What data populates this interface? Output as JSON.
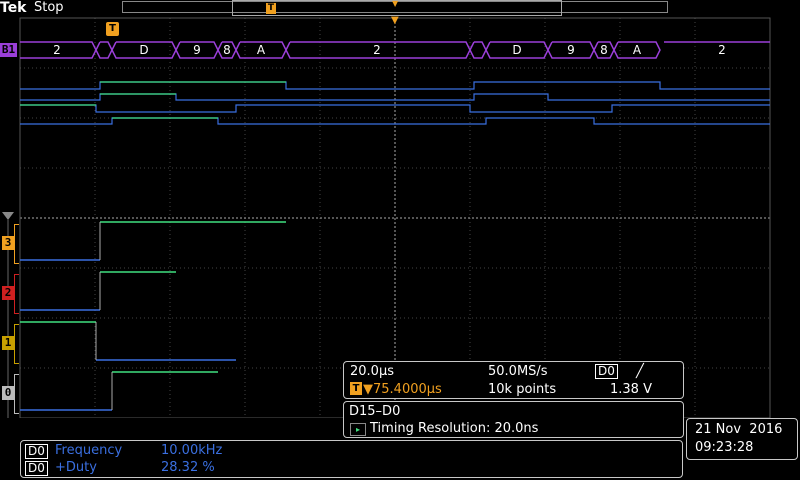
{
  "header": {
    "brand": "Tek",
    "status": "Stop",
    "trigger_marker": "T"
  },
  "bus": {
    "label": "B1",
    "values": [
      "2",
      "D",
      "9",
      "8",
      "A",
      "2",
      "D",
      "9",
      "8",
      "A",
      "2"
    ]
  },
  "channels": [
    {
      "label": "3",
      "color": "#f0a020"
    },
    {
      "label": "2",
      "color": "#d02020"
    },
    {
      "label": "1",
      "color": "#c8a000"
    },
    {
      "label": "0",
      "color": "#bbbbbb"
    }
  ],
  "acquisition": {
    "timebase": "20.0µs",
    "sample_rate": "50.0MS/s",
    "trigger_source": "D0",
    "trigger_slope": "╱",
    "trigger_pos": "▼75.4000µs",
    "trigger_badge": "T",
    "record_length": "10k points",
    "trigger_level": "1.38 V"
  },
  "decode": {
    "range": "D15–D0",
    "resolution": "Timing Resolution: 20.0ns"
  },
  "measurements": [
    {
      "source": "D0",
      "name": "Frequency",
      "value": "10.00kHz"
    },
    {
      "source": "D0",
      "name": "+Duty",
      "value": "28.32 %"
    }
  ],
  "datetime": {
    "date": "21 Nov  2016",
    "time": "09:23:28"
  },
  "colors": {
    "bus": "#9a3fd8",
    "trace_high": "#40e080",
    "trace_low": "#3a6fe0",
    "grid": "#444444",
    "accent": "#f0a020"
  }
}
